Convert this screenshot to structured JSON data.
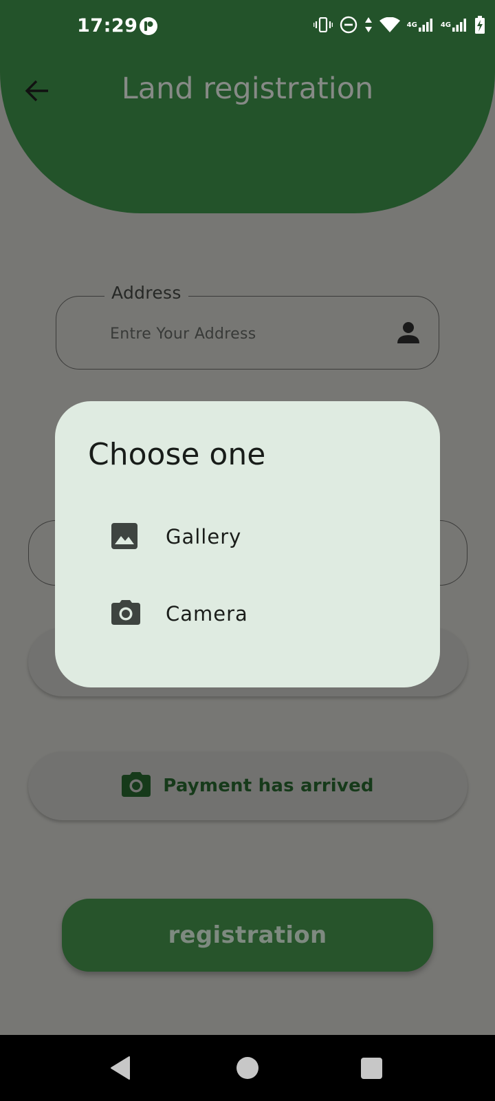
{
  "status_bar": {
    "time": "17:29",
    "icons": [
      "app-notification-icon",
      "vibrate-icon",
      "do-not-disturb-icon",
      "data-arrows-icon",
      "wifi-icon",
      "signal-4g-sim1-icon",
      "signal-4g-sim2-icon",
      "battery-charging-icon"
    ],
    "sim1_label": "4G",
    "sim2_label": "4G"
  },
  "header": {
    "title": "Land registration",
    "color": "#23532a"
  },
  "form": {
    "address_label": "Address",
    "address_placeholder": "Entre Your Address",
    "payment_label": "Payment has arrived",
    "submit_label": "registration"
  },
  "dialog": {
    "title": "Choose one",
    "options": [
      {
        "label": "Gallery",
        "icon": "image-icon"
      },
      {
        "label": "Camera",
        "icon": "camera-icon"
      }
    ]
  },
  "colors": {
    "accent": "#23532a",
    "scrim": "#777774",
    "dialog_bg": "#dfebe1"
  }
}
